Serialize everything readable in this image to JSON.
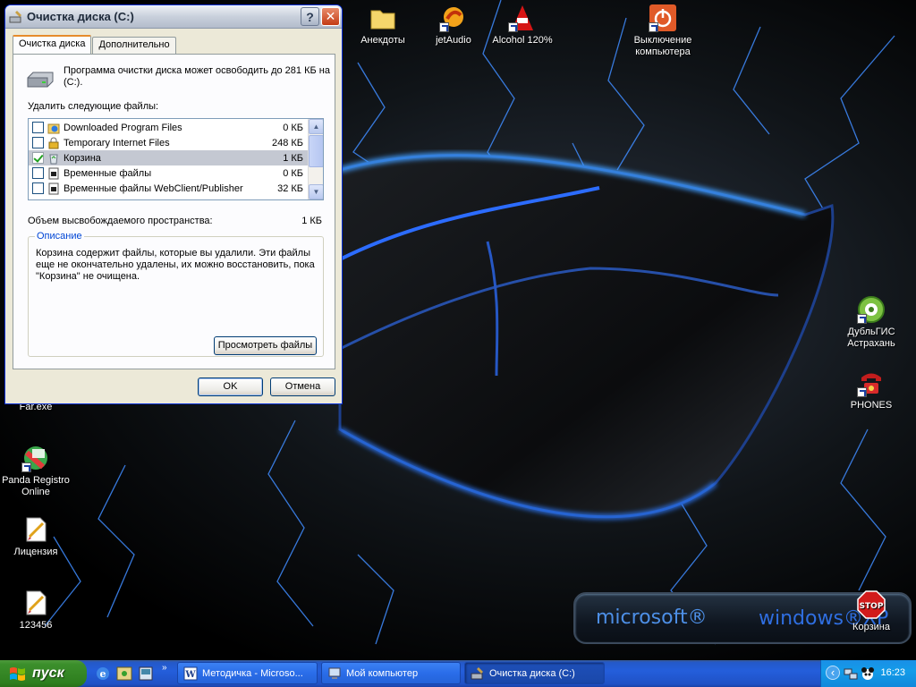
{
  "desktop": {
    "icons": [
      {
        "id": "anekdoty",
        "label": "Анекдоты"
      },
      {
        "id": "jetaudio",
        "label": "jetAudio"
      },
      {
        "id": "alcohol",
        "label": "Alcohol 120%"
      },
      {
        "id": "shutdown",
        "label": "Выключение компьютера"
      },
      {
        "id": "far",
        "label": "Far.exe"
      },
      {
        "id": "panda",
        "label": "Panda Registro Online"
      },
      {
        "id": "license",
        "label": "Лицензия"
      },
      {
        "id": "n123456",
        "label": "123456"
      },
      {
        "id": "dublgis",
        "label": "ДубльГИС Астрахань"
      },
      {
        "id": "phones",
        "label": "PHONES"
      },
      {
        "id": "recycle",
        "label": "Корзина"
      }
    ],
    "brand": {
      "left": "microsoft®",
      "right": "windows®XP"
    }
  },
  "window": {
    "title": "Очистка диска  (C:)",
    "help_btn": "?",
    "close_btn": "✕",
    "tabs": [
      "Очистка диска",
      "Дополнительно"
    ],
    "info_text": "Программа очистки диска может освободить до 281 КБ на  (C:).",
    "delete_label": "Удалить следующие файлы:",
    "files": [
      {
        "name": "Downloaded Program Files",
        "size": "0 КБ",
        "checked": false,
        "selected": false
      },
      {
        "name": "Temporary Internet Files",
        "size": "248 КБ",
        "checked": false,
        "selected": false
      },
      {
        "name": "Корзина",
        "size": "1 КБ",
        "checked": true,
        "selected": true
      },
      {
        "name": "Временные файлы",
        "size": "0 КБ",
        "checked": false,
        "selected": false
      },
      {
        "name": "Временные файлы WebClient/Publisher",
        "size": "32 КБ",
        "checked": false,
        "selected": false
      }
    ],
    "free_label": "Объем высвобождаемого пространства:",
    "free_value": "1 КБ",
    "desc_title": "Описание",
    "desc_text": "Корзина содержит файлы, которые вы удалили. Эти файлы еще не окончательно удалены, их можно восстановить, пока \"Корзина\" не очищена.",
    "view_files_btn": "Просмотреть файлы",
    "ok_btn": "OK",
    "cancel_btn": "Отмена"
  },
  "taskbar": {
    "start_label": "пуск",
    "quicklaunch_more": "»",
    "tasks": [
      {
        "label": "Методичка - Microso...",
        "active": false
      },
      {
        "label": "Мой компьютер",
        "active": false
      },
      {
        "label": "Очистка диска  (C:)",
        "active": true
      }
    ],
    "tray_expand": "‹",
    "clock": "16:23"
  }
}
